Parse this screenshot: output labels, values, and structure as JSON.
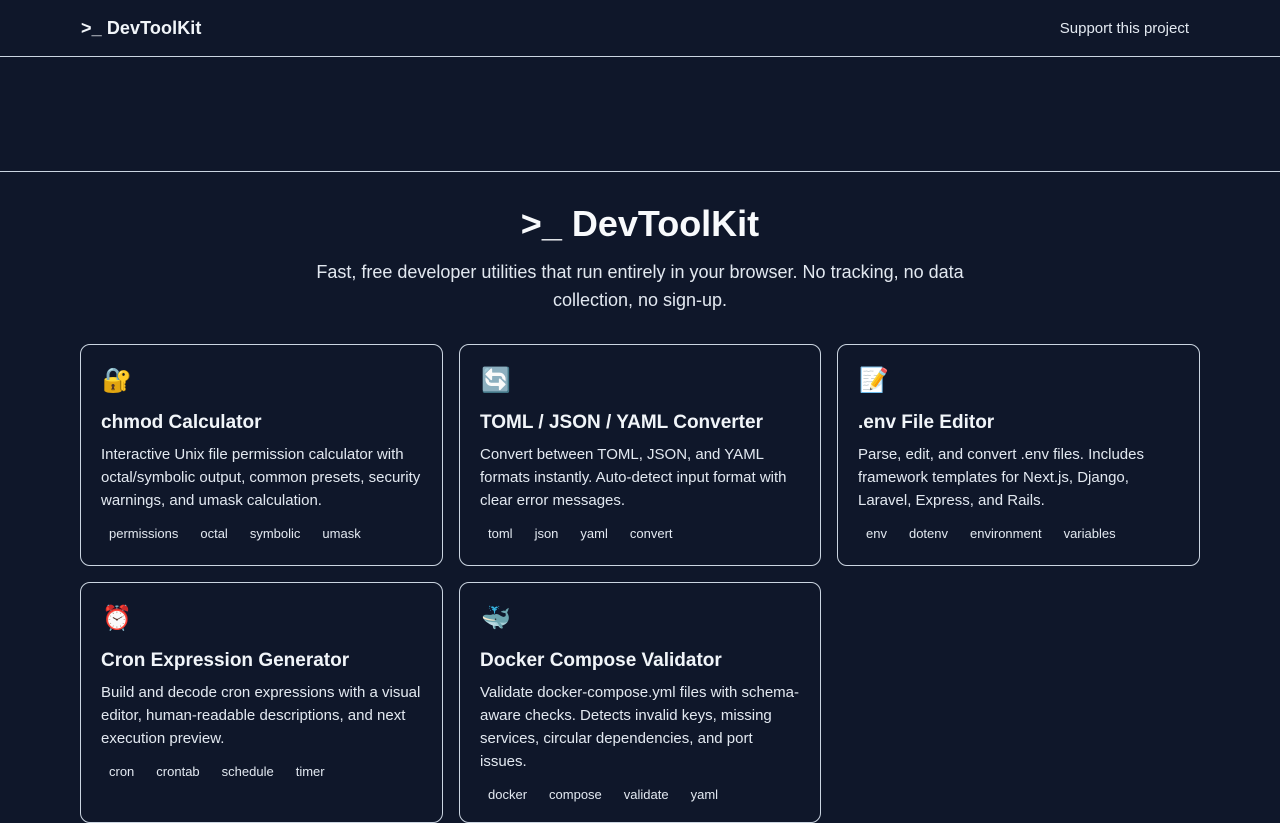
{
  "nav": {
    "brand": ">_ DevToolKit",
    "support_link": "Support this project"
  },
  "hero": {
    "title": ">_ DevToolKit",
    "subtitle": "Fast, free developer utilities that run entirely in your browser. No tracking, no data collection, no sign-up."
  },
  "tools": [
    {
      "icon": "🔐",
      "icon_name": "lock-with-key-icon",
      "title": "chmod Calculator",
      "description": "Interactive Unix file permission calculator with octal/symbolic output, common presets, security warnings, and umask calculation.",
      "tags": [
        "permissions",
        "octal",
        "symbolic",
        "umask"
      ]
    },
    {
      "icon": "🔄",
      "icon_name": "refresh-arrows-icon",
      "title": "TOML / JSON / YAML Converter",
      "description": "Convert between TOML, JSON, and YAML formats instantly. Auto-detect input format with clear error messages.",
      "tags": [
        "toml",
        "json",
        "yaml",
        "convert"
      ]
    },
    {
      "icon": "📝",
      "icon_name": "memo-icon",
      "title": ".env File Editor",
      "description": "Parse, edit, and convert .env files. Includes framework templates for Next.js, Django, Laravel, Express, and Rails.",
      "tags": [
        "env",
        "dotenv",
        "environment",
        "variables"
      ]
    },
    {
      "icon": "⏰",
      "icon_name": "alarm-clock-icon",
      "title": "Cron Expression Generator",
      "description": "Build and decode cron expressions with a visual editor, human-readable descriptions, and next execution preview.",
      "tags": [
        "cron",
        "crontab",
        "schedule",
        "timer"
      ]
    },
    {
      "icon": "🐳",
      "icon_name": "whale-icon",
      "title": "Docker Compose Validator",
      "description": "Validate docker-compose.yml files with schema-aware checks. Detects invalid keys, missing services, circular dependencies, and port issues.",
      "tags": [
        "docker",
        "compose",
        "validate",
        "yaml"
      ]
    }
  ]
}
